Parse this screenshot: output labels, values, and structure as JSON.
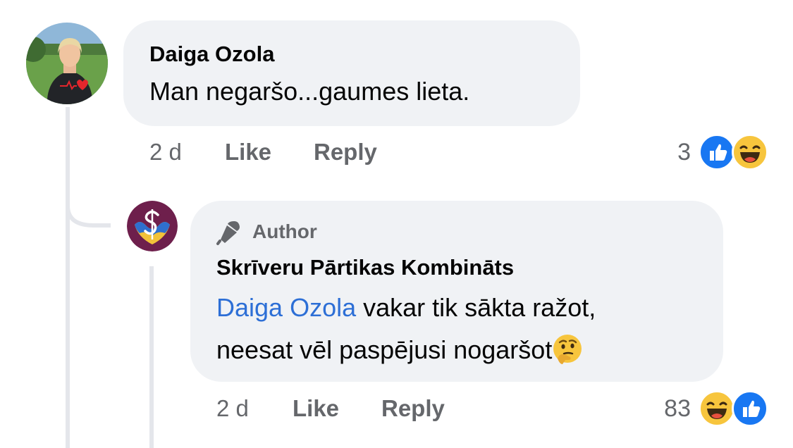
{
  "comment": {
    "author": "Daiga Ozola",
    "text": "Man negaršo...gaumes lieta.",
    "time": "2 d",
    "like_label": "Like",
    "reply_label": "Reply",
    "reaction_count": "3",
    "reactions": [
      "like-icon",
      "haha-icon"
    ]
  },
  "reply": {
    "badge_icon": "microphone-icon",
    "badge_label": "Author",
    "author": "Skrīveru Pārtikas Kombināts",
    "mention": "Daiga Ozola",
    "text_line1": " vakar tik sākta ražot,",
    "text_line2": "neesat vēl paspējusi nogaršot",
    "emoji": "🤔",
    "time": "2 d",
    "like_label": "Like",
    "reply_label": "Reply",
    "reaction_count": "83",
    "reactions": [
      "haha-icon",
      "like-icon"
    ]
  },
  "colors": {
    "bubble": "#f0f2f5",
    "meta": "#65676b",
    "mention": "#2d6fd6",
    "like_blue": "#1877f2",
    "haha_yellow": "#f7c53d",
    "brand_maroon": "#6e1f4c"
  }
}
